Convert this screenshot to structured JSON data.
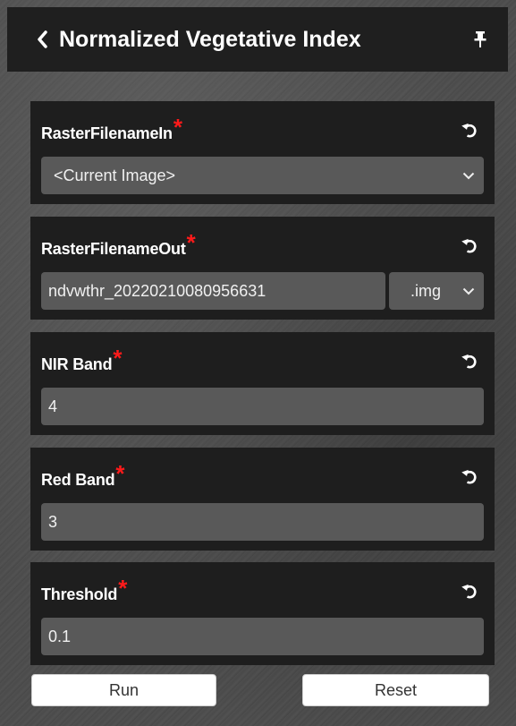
{
  "header": {
    "title": "Normalized Vegetative Index",
    "back_icon": "chevron-left-icon",
    "pin_icon": "pin-icon"
  },
  "required_marker": "*",
  "colors": {
    "card_bg": "#1e1e1e",
    "field_bg": "#595959",
    "required": "#ff1a1a",
    "title_bg": "#1f1f1f"
  },
  "params": [
    {
      "label": "RasterFilenameIn",
      "type": "select",
      "value": "<Current Image>"
    },
    {
      "label": "RasterFilenameOut",
      "type": "file-output",
      "value": "ndvwthr_20220210080956631",
      "extension": ".img"
    },
    {
      "label": "NIR Band",
      "type": "text",
      "value": "4"
    },
    {
      "label": "Red Band",
      "type": "text",
      "value": "3"
    },
    {
      "label": "Threshold",
      "type": "text",
      "value": "0.1"
    }
  ],
  "actions": {
    "run_label": "Run",
    "reset_label": "Reset"
  }
}
